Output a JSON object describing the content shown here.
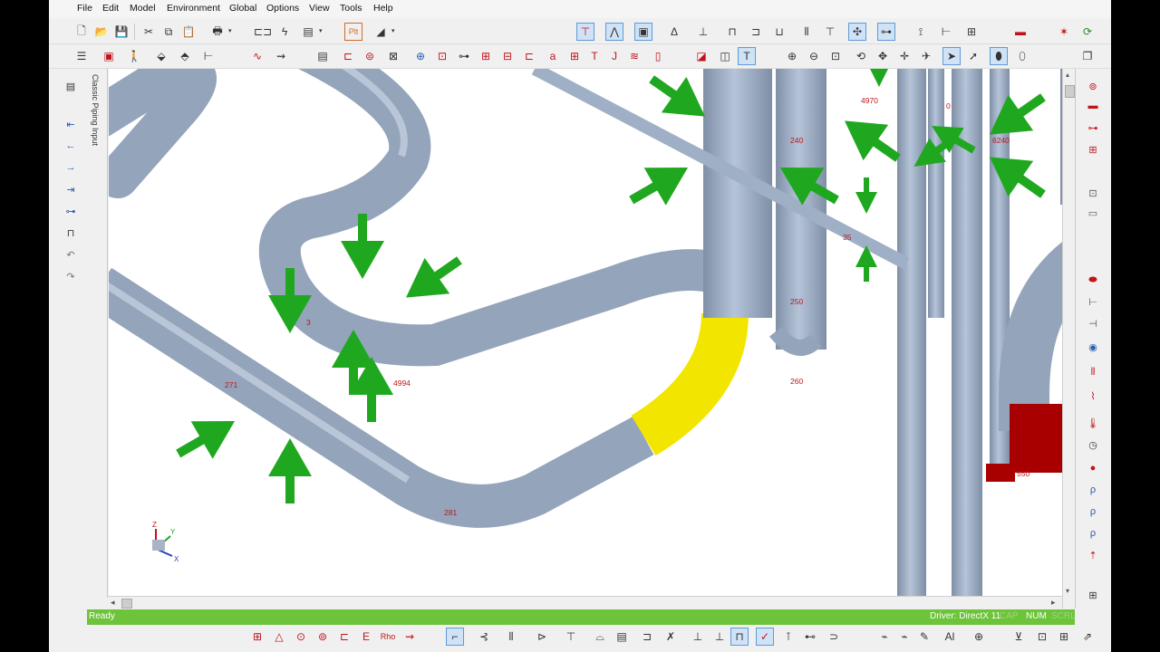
{
  "menu": [
    "File",
    "Edit",
    "Model",
    "Environment",
    "Global",
    "Options",
    "View",
    "Tools",
    "Help"
  ],
  "left_panel": {
    "title": "Classic Piping Input",
    "buttons": [
      "first-element-icon",
      "previous-element-icon",
      "next-element-icon",
      "last-element-icon",
      "find-element-icon",
      "duplicate-icon",
      "undo-icon",
      "redo-icon"
    ]
  },
  "nodes": {
    "n4970": "4970",
    "n240": "240",
    "n6240": "6240",
    "n250": "250",
    "n260": "260",
    "n271": "271",
    "n4994": "4994",
    "n281": "281",
    "n3": "3",
    "n35": "35",
    "n0": "0",
    "n550": "550"
  },
  "axes": {
    "z": "Z",
    "y": "Y",
    "x": "X"
  },
  "status": {
    "left": "Ready",
    "driver": "Driver: DirectX 11",
    "cap": "CAP",
    "num": "NUM",
    "scrl": "SCRL"
  },
  "colors": {
    "pipe": "#9fb0c6",
    "selected_bend": "#f2e600",
    "restraint_arrow": "#1fa81f",
    "hanger_block": "#a80000",
    "status_bar": "#6dc33a"
  }
}
